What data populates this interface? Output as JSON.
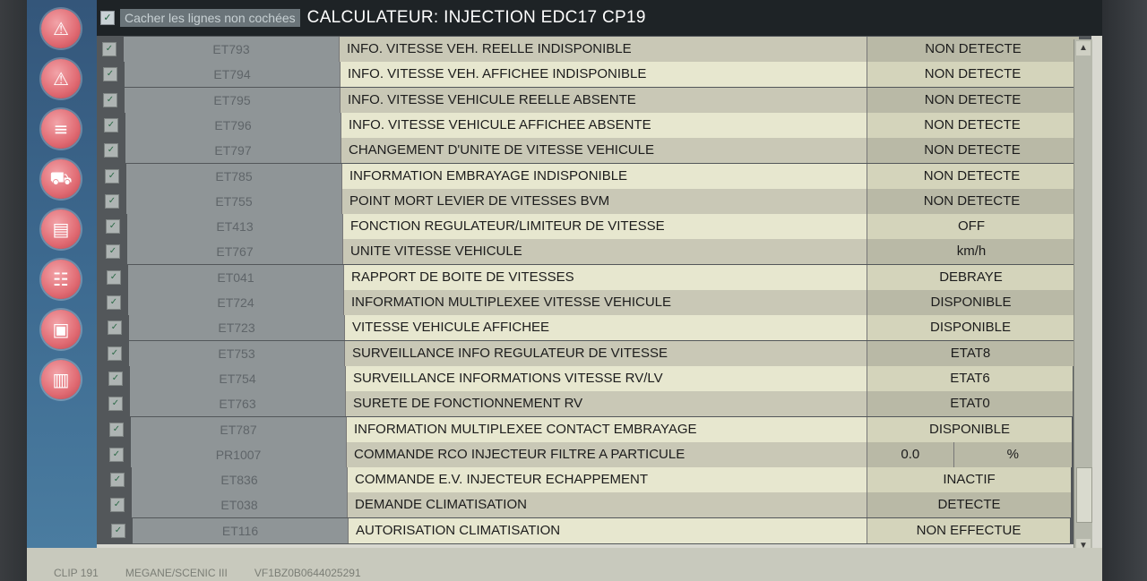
{
  "header": {
    "hide_label": "Cacher les lignes non cochées",
    "title": "CALCULATEUR: INJECTION EDC17 CP19"
  },
  "sidebar": {
    "icons": [
      "warning-icon",
      "alert-icon",
      "parameters-icon",
      "vehicle-icon",
      "book-icon",
      "network-icon",
      "save-vehicle-icon",
      "barcode-icon"
    ]
  },
  "rows": [
    {
      "code": "ET793",
      "label": "INFO. VITESSE VEH. REELLE INDISPONIBLE",
      "value": "NON DETECTE"
    },
    {
      "code": "ET794",
      "label": "INFO. VITESSE VEH. AFFICHEE INDISPONIBLE",
      "value": "NON DETECTE"
    },
    {
      "code": "ET795",
      "label": "INFO. VITESSE VEHICULE REELLE ABSENTE",
      "value": "NON DETECTE"
    },
    {
      "code": "ET796",
      "label": "INFO. VITESSE VEHICULE AFFICHEE ABSENTE",
      "value": "NON DETECTE"
    },
    {
      "code": "ET797",
      "label": "CHANGEMENT D'UNITE DE VITESSE VEHICULE",
      "value": "NON DETECTE"
    },
    {
      "code": "ET785",
      "label": "INFORMATION EMBRAYAGE INDISPONIBLE",
      "value": "NON DETECTE"
    },
    {
      "code": "ET755",
      "label": "POINT MORT LEVIER DE VITESSES BVM",
      "value": "NON DETECTE"
    },
    {
      "code": "ET413",
      "label": "FONCTION REGULATEUR/LIMITEUR DE VITESSE",
      "value": "OFF"
    },
    {
      "code": "ET767",
      "label": "UNITE VITESSE VEHICULE",
      "value": "km/h"
    },
    {
      "code": "ET041",
      "label": "RAPPORT DE BOITE DE VITESSES",
      "value": "DEBRAYE"
    },
    {
      "code": "ET724",
      "label": "INFORMATION MULTIPLEXEE VITESSE VEHICULE",
      "value": "DISPONIBLE"
    },
    {
      "code": "ET723",
      "label": "VITESSE VEHICULE AFFICHEE",
      "value": "DISPONIBLE"
    },
    {
      "code": "ET753",
      "label": "SURVEILLANCE INFO REGULATEUR DE VITESSE",
      "value": "ETAT8"
    },
    {
      "code": "ET754",
      "label": "SURVEILLANCE INFORMATIONS VITESSE RV/LV",
      "value": "ETAT6"
    },
    {
      "code": "ET763",
      "label": "SURETE DE FONCTIONNEMENT RV",
      "value": "ETAT0"
    },
    {
      "code": "ET787",
      "label": "INFORMATION MULTIPLEXEE CONTACT EMBRAYAGE",
      "value": "DISPONIBLE"
    },
    {
      "code": "PR1007",
      "label": "COMMANDE RCO INJECTEUR FILTRE A PARTICULE",
      "value": "0.0",
      "unit": "%"
    },
    {
      "code": "ET836",
      "label": "COMMANDE E.V. INJECTEUR ECHAPPEMENT",
      "value": "INACTIF"
    },
    {
      "code": "ET038",
      "label": "DEMANDE CLIMATISATION",
      "value": "DETECTE"
    },
    {
      "code": "ET116",
      "label": "AUTORISATION CLIMATISATION",
      "value": "NON EFFECTUE"
    }
  ],
  "status": {
    "left": "CLIP 191",
    "middle": "MEGANE/SCENIC III",
    "right": "VF1BZ0B0644025291"
  }
}
